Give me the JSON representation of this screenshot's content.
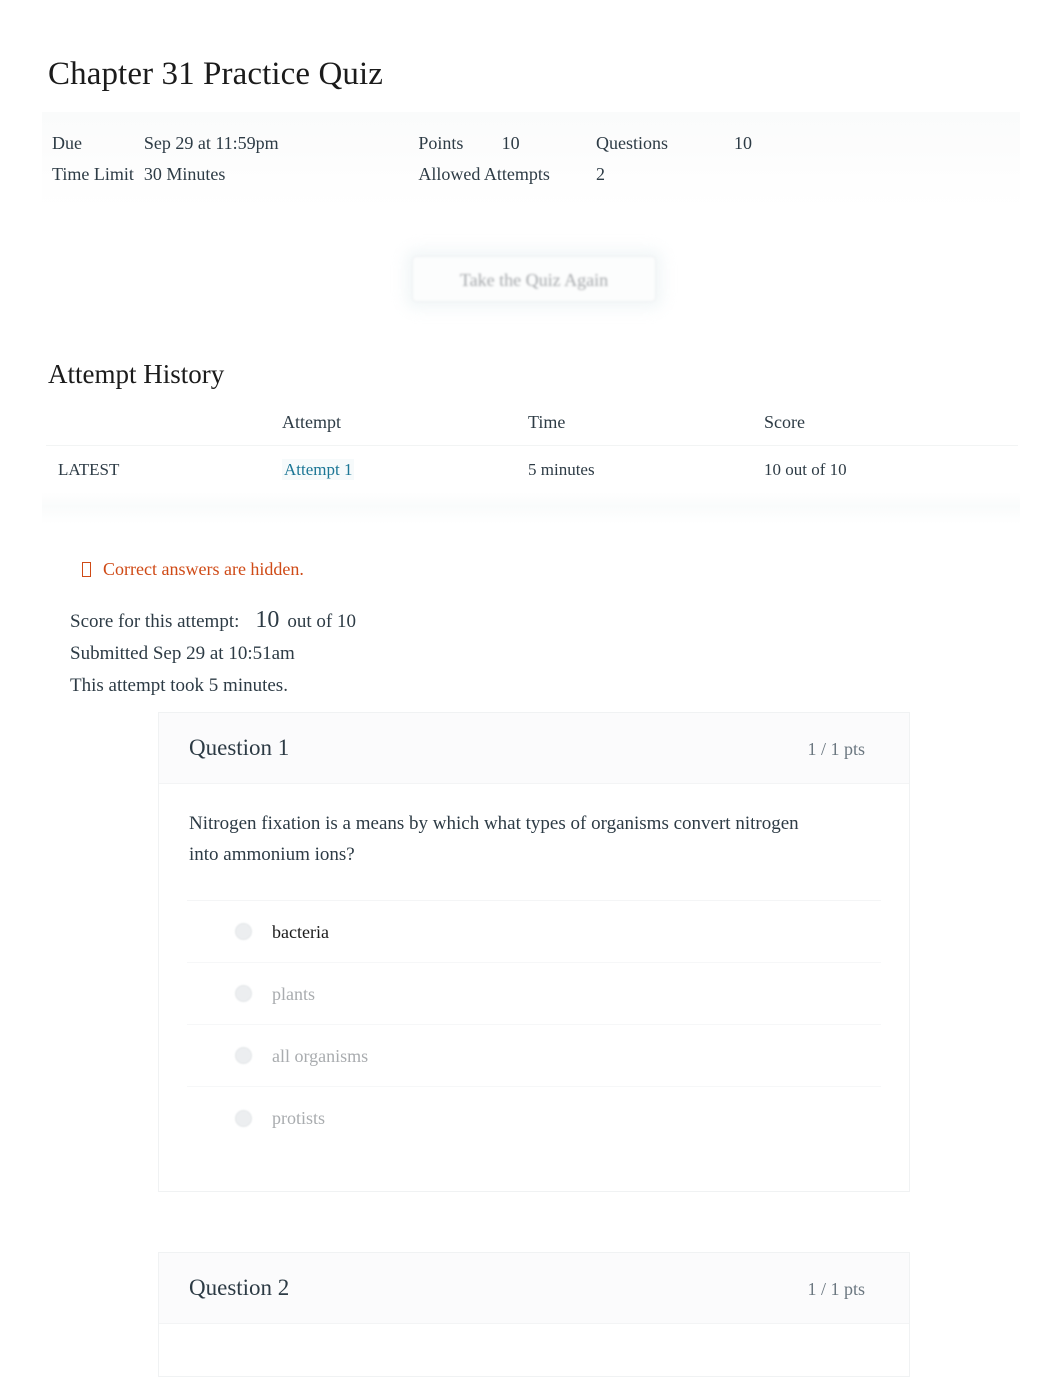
{
  "quiz": {
    "title": "Chapter 31 Practice Quiz",
    "meta": {
      "due_label": "Due",
      "due_value": "Sep 29 at 11:59pm",
      "points_label": "Points",
      "points_value": "10",
      "questions_label": "Questions",
      "questions_value": "10",
      "time_limit_label": "Time Limit",
      "time_limit_value": "30 Minutes",
      "allowed_attempts_label": "Allowed Attempts",
      "allowed_attempts_value": "2"
    },
    "retake_button_label": "Take the Quiz Again"
  },
  "attempt_history": {
    "heading": "Attempt History",
    "columns": [
      "",
      "Attempt",
      "Time",
      "Score"
    ],
    "rows": [
      {
        "marker": "LATEST",
        "attempt": "Attempt 1",
        "time": "5 minutes",
        "score": "10 out of 10"
      }
    ]
  },
  "notice": {
    "icon": "warning-tofu-icon",
    "text": "Correct answers are hidden.",
    "color": "#cf4a16"
  },
  "score_summary": {
    "score_label": "Score for this attempt:",
    "score_value": "10",
    "score_suffix": "out of 10",
    "submitted": "Submitted Sep 29 at 10:51am",
    "duration": "This attempt took 5 minutes."
  },
  "questions": [
    {
      "name": "Question 1",
      "points": "1 / 1 pts",
      "text": "Nitrogen fixation is a means by which what types of organisms convert nitrogen into ammonium ions?",
      "answers": [
        {
          "label": "bacteria",
          "selected": true
        },
        {
          "label": "plants",
          "selected": false
        },
        {
          "label": "all organisms",
          "selected": false
        },
        {
          "label": "protists",
          "selected": false
        }
      ]
    },
    {
      "name": "Question 2",
      "points": "1 / 1 pts",
      "text": "",
      "answers": []
    }
  ],
  "colors": {
    "link": "#1b7695",
    "notice": "#cf4a16",
    "text": "#2d3b45",
    "muted": "#a9acaf"
  }
}
